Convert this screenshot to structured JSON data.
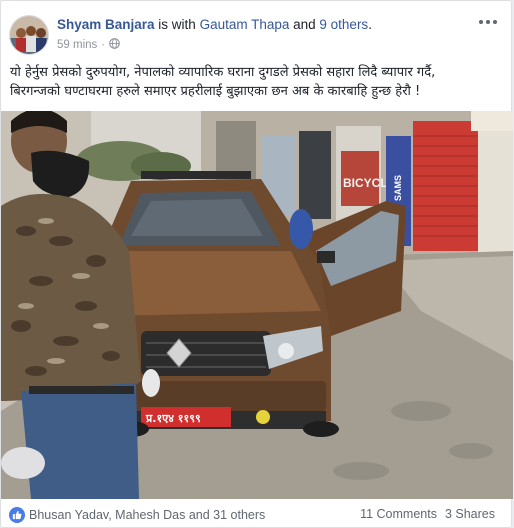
{
  "post": {
    "author": "Shyam Banjara",
    "with_text": " is with ",
    "tagged_person": "Gautam Thapa",
    "and_text": " and ",
    "others_text": "9 others",
    "period": ".",
    "time": "59 mins",
    "privacy_icon": "globe-icon",
    "more_icon": "more-options-icon",
    "text_line1": "यो हेर्नुस प्रेसको दुरुपयोग, नेपालको व्यापारिक घराना दुगडले प्रेसको सहारा लिदै ब्यापार गर्दै,",
    "text_line2": "बिरगन्जको घण्टाघरमा हरुले समाएर प्रहरीलाई बुझाएका छन अब के कारबाहि हुन्छ हेरौ !",
    "plate_text": "प्र.१ए४ ११९९"
  },
  "footer": {
    "reaction_icon": "like-icon",
    "reactions": "Bhusan Yadav, Mahesh Das and 31 others",
    "comments": "11 Comments",
    "shares": "3 Shares"
  },
  "colors": {
    "link": "#365899",
    "like": "#4a7ce9",
    "text": "#1d2129",
    "muted": "#90949c"
  }
}
